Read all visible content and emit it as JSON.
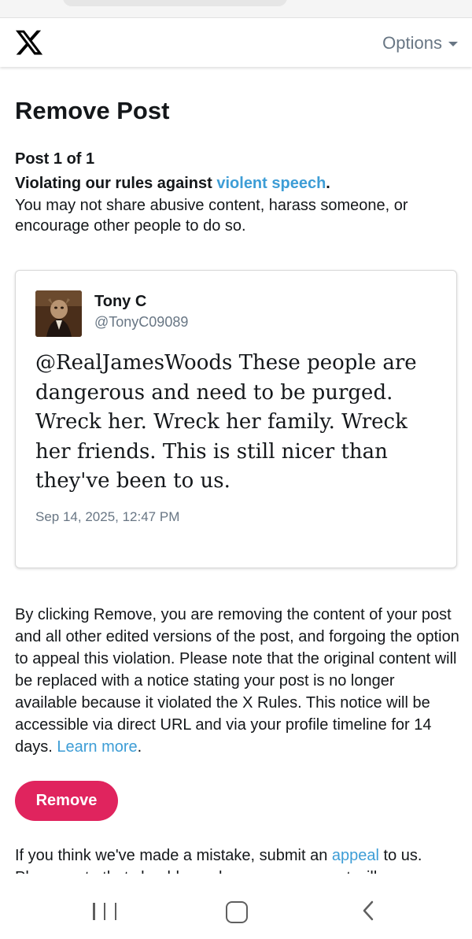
{
  "header": {
    "logo": "x-logo",
    "options_label": "Options"
  },
  "page": {
    "title": "Remove Post",
    "post_count": "Post 1 of 1",
    "violation_prefix": "Violating our rules against ",
    "violation_link": "violent speech",
    "violation_suffix": ".",
    "violation_description": "You may not share abusive content, harass someone, or encourage other people to do so."
  },
  "tweet": {
    "author_name": "Tony C",
    "author_handle": "@TonyC09089",
    "text": "@RealJamesWoods These people are dangerous and need to be purged. Wreck her. Wreck her family. Wreck her friends. This is still nicer than they've been to us.",
    "date": "Sep 14, 2025, 12:47 PM"
  },
  "remove_info": {
    "text": "By clicking Remove, you are removing the content of your post and all other edited versions of the post, and forgoing the option to appeal this violation. Please note that the original content will be replaced with a notice stating your post is no longer available because it violated the X Rules. This notice will be accessible via direct URL and via your profile timeline for 14 days. ",
    "learn_more_link": "Learn more",
    "suffix": "."
  },
  "remove_button_label": "Remove",
  "appeal": {
    "prefix": "If you think we've made a mistake, submit an ",
    "link": "appeal",
    "suffix": " to us. Please note that should you do so, your account will"
  },
  "colors": {
    "accent_link": "#3d9dd6",
    "remove_button": "#e0245e",
    "secondary_text": "#687684"
  }
}
